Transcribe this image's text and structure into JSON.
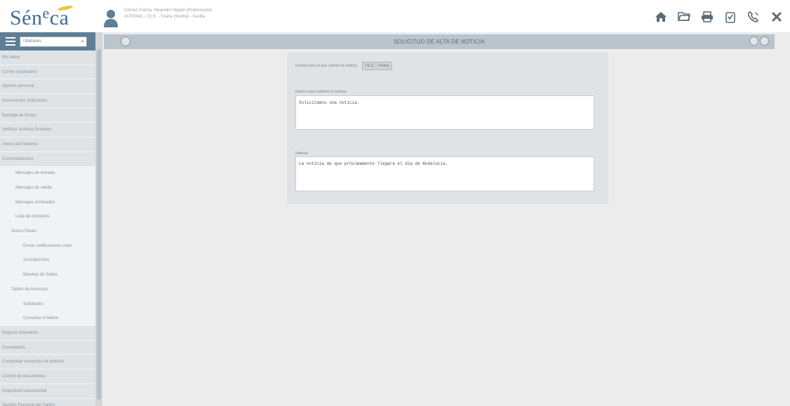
{
  "header": {
    "logo_main": "Sén",
    "logo_sup": "e",
    "logo_tail": "ca",
    "user_line1": "Gómez García, Alejandro Miguel (Profesorado)",
    "user_line2": "41700041 - I.E.S. - Triana (Sevilla) - Sevilla",
    "icons": [
      "home-icon",
      "folder-icon",
      "print-icon",
      "clipboard-icon",
      "phone-icon",
      "close-icon"
    ]
  },
  "sidebar": {
    "select_value": "Utilidades",
    "items": [
      {
        "label": "Mis datos",
        "level": "l0"
      },
      {
        "label": "Correo corporativo",
        "level": "l0"
      },
      {
        "label": "Agenda personal",
        "level": "l0"
      },
      {
        "label": "Documentos Solicitados",
        "level": "l0"
      },
      {
        "label": "Bandeja de firmas",
        "level": "l0"
      },
      {
        "label": "Verificar archivos firmados",
        "level": "l0"
      },
      {
        "label": "Avisos del Sistema",
        "level": "l0"
      },
      {
        "label": "Comunicaciones",
        "level": "l0"
      },
      {
        "label": "Mensajes de entrada",
        "level": "l1"
      },
      {
        "label": "Mensajes de salida",
        "level": "l1"
      },
      {
        "label": "Mensajes archivados",
        "level": "l1"
      },
      {
        "label": "Lista de contactos",
        "level": "l1"
      },
      {
        "label": "Avisos Pasen",
        "level": "l1b"
      },
      {
        "label": "Enviar notificaciones masi",
        "level": "l2"
      },
      {
        "label": "Suscripciones",
        "level": "l2"
      },
      {
        "label": "Bandeja de Salida",
        "level": "l2"
      },
      {
        "label": "Tablón de Anuncios",
        "level": "l1b"
      },
      {
        "label": "Solicitudes",
        "level": "l2"
      },
      {
        "label": "Consultar el tablón",
        "level": "l2"
      },
      {
        "label": "Registro telemático",
        "level": "l0"
      },
      {
        "label": "Escaneados",
        "level": "l0"
      },
      {
        "label": "Comprobar recepción de petición",
        "level": "l0"
      },
      {
        "label": "Control de documentos",
        "level": "l0"
      },
      {
        "label": "Repositorio documental",
        "level": "l0"
      },
      {
        "label": "Gestión Personal del Centro",
        "level": "l0"
      }
    ]
  },
  "main": {
    "title": "SOLICITUD DE ALTA DE NOTICIA",
    "centro_label": "Centro para el que solicita la noticia:",
    "centro_value": "I.E.S. - Triana",
    "razon_label": "Razón para solicitar la noticia:",
    "razon_value": "Solicitamos una noticia.",
    "noticia_label": "Noticia:",
    "noticia_value": "La noticia de que próximamente llegará el día de Andalucía."
  }
}
